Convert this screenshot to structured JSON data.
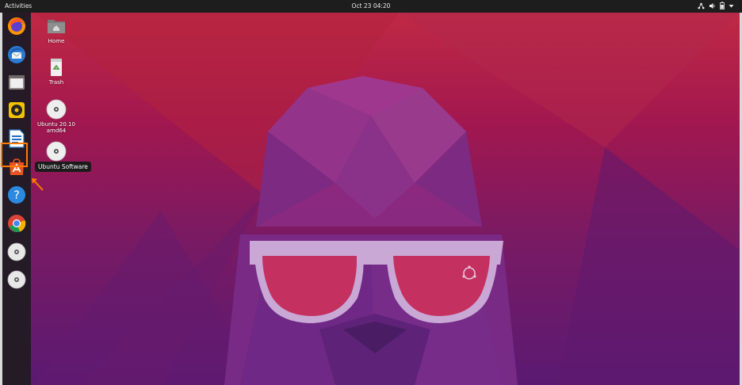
{
  "topbar": {
    "activities_label": "Activities",
    "clock": "Oct 23  04:20",
    "tray_icons": [
      "network-icon",
      "volume-icon",
      "battery-icon",
      "system-menu-chevron-icon"
    ]
  },
  "dock": {
    "items": [
      {
        "name": "Firefox",
        "icon": "firefox-icon"
      },
      {
        "name": "Thunderbird",
        "icon": "thunderbird-icon"
      },
      {
        "name": "Files",
        "icon": "files-icon"
      },
      {
        "name": "Rhythmbox",
        "icon": "rhythmbox-icon"
      },
      {
        "name": "LibreOffice Writer",
        "icon": "writer-icon"
      },
      {
        "name": "Ubuntu Software",
        "icon": "ubuntu-software-icon"
      },
      {
        "name": "Help",
        "icon": "help-icon"
      },
      {
        "name": "Google Chrome",
        "icon": "chrome-icon"
      },
      {
        "name": "Disc",
        "icon": "disc-icon"
      },
      {
        "name": "Disc",
        "icon": "disc-icon"
      }
    ],
    "highlighted_item": "Ubuntu Software",
    "tooltip": "Ubuntu Software",
    "highlight_color": "#ff7a00"
  },
  "desktop": {
    "icons": [
      {
        "label": "Home",
        "icon": "home-folder-icon"
      },
      {
        "label": "Trash",
        "icon": "trash-icon"
      },
      {
        "label": "Ubuntu 20.10\namd64",
        "icon": "disc-icon"
      },
      {
        "label": "",
        "icon": "disc-icon"
      }
    ]
  },
  "colors": {
    "topbar": "#1d1d1d",
    "dock": "#241b26",
    "wallpaper_top": "#c02944",
    "wallpaper_bottom": "#5a1a72",
    "accent": "#e95420"
  }
}
